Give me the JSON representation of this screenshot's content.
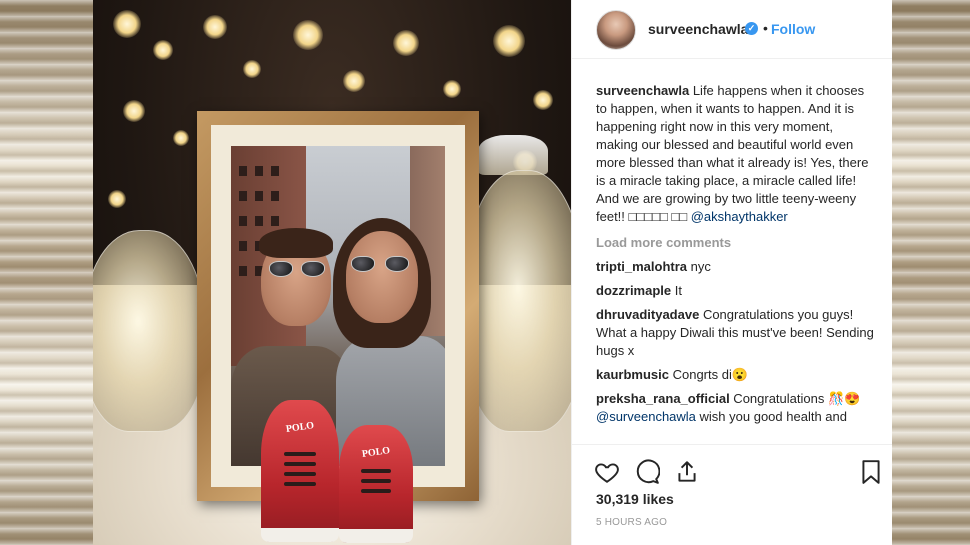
{
  "post": {
    "username": "surveenchawla",
    "follow_label": "Follow",
    "separator": "•",
    "verified_mark": "✓"
  },
  "caption": {
    "username": "surveenchawla",
    "text": " Life happens when it chooses to happen, when it wants to happen. And it is happening right now in this very moment, making our blessed and beautiful world even more blessed than what it already is! Yes, there is a miracle taking place, a miracle called life! And we are growing by two little teeny-weeny feet!! ",
    "emoji_text": "□□□□□ □□ ",
    "mention": "@akshaythakker"
  },
  "load_more": "Load more comments",
  "comments": [
    {
      "user": "tripti_malohtra",
      "text": " nyc"
    },
    {
      "user": "dozzrimaple",
      "text": " It"
    },
    {
      "user": "dhruvadityadave",
      "text": " Congratulations you guys! What a happy Diwali this must've been! Sending hugs x"
    },
    {
      "user": "kaurbmusic",
      "text": " Congrts di😮"
    },
    {
      "user": "preksha_rana_official",
      "text": " Congratulations 🎊😍 ",
      "mention": "@surveenchawla",
      "text2": " wish you good health and"
    }
  ],
  "actions": {
    "like_icon": "heart-icon",
    "comment_icon": "comment-icon",
    "share_icon": "share-icon",
    "save_icon": "bookmark-icon"
  },
  "likes": "30,319 likes",
  "timestamp": "5 HOURS AGO",
  "photo": {
    "shoe_brand": "POLO"
  }
}
